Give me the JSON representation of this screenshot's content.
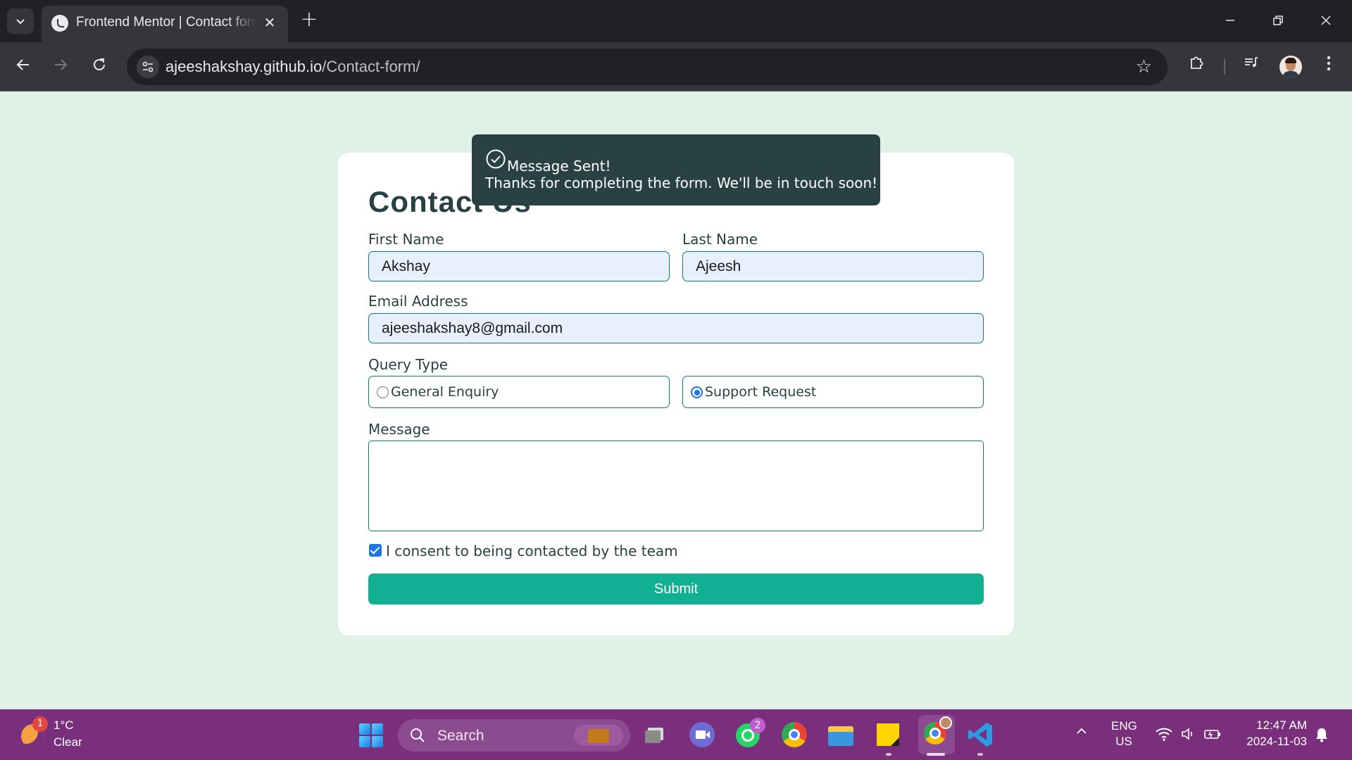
{
  "browser": {
    "tab_title": "Frontend Mentor | Contact form",
    "new_tab_symbol": "+",
    "close_symbol": "✕",
    "url_host": "ajeeshakshay.github.io",
    "url_path": "/Contact-form/"
  },
  "form": {
    "heading": "Contact Us",
    "first_name_label": "First Name",
    "first_name_value": "Akshay",
    "last_name_label": "Last Name",
    "last_name_value": "Ajeesh",
    "email_label": "Email Address",
    "email_value": "ajeeshakshay8@gmail.com",
    "query_label": "Query Type",
    "query_options": [
      {
        "label": "General Enquiry",
        "checked": false
      },
      {
        "label": "Support Request",
        "checked": true
      }
    ],
    "message_label": "Message",
    "message_value": "",
    "consent_label": "I consent to being contacted by the team",
    "consent_checked": true,
    "submit_label": "Submit"
  },
  "toast": {
    "title": "Message Sent!",
    "body": "Thanks for completing the form. We'll be in touch soon!"
  },
  "taskbar": {
    "weather_badge": "1",
    "weather_temp": "1°C",
    "weather_condition": "Clear",
    "search_placeholder": "Search",
    "whatsapp_badge": "2",
    "language": "ENG",
    "region": "US",
    "time": "12:47 AM",
    "date": "2024-11-03"
  },
  "colors": {
    "page_background": "#e0f1e8",
    "accent": "#11b092",
    "dark_text": "#2a4144",
    "taskbar": "#7a2f7c"
  }
}
